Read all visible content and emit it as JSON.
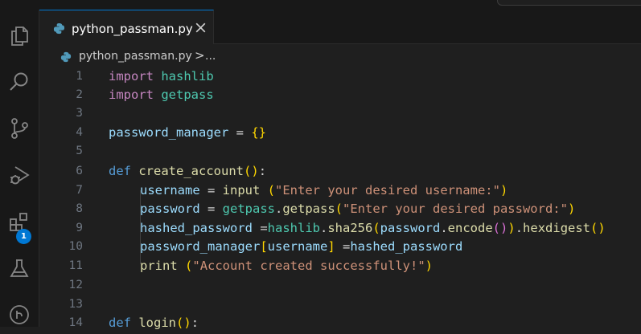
{
  "tab": {
    "filename": "python_passman.py"
  },
  "breadcrumb": {
    "file": "python_passman.py",
    "separator": ">",
    "more": "..."
  },
  "activity_bar": {
    "items": [
      "files-icon",
      "search-icon",
      "source-control-icon",
      "run-debug-icon",
      "extensions-icon",
      "testing-icon",
      "git-graph-icon"
    ],
    "extensions_badge": "1"
  },
  "colors": {
    "accent": "#0078d4",
    "keyword": "#c586c0",
    "def_keyword": "#569cd6",
    "function": "#dcdcaa",
    "module": "#4ec9b0",
    "variable": "#9cdcfe",
    "string": "#ce9178"
  },
  "code": {
    "line_numbers": [
      "1",
      "2",
      "3",
      "4",
      "5",
      "6",
      "7",
      "8",
      "9",
      "10",
      "11",
      "12",
      "13",
      "14"
    ],
    "l1": {
      "kw": "import",
      "sp": " ",
      "mod": "hashlib"
    },
    "l2": {
      "kw": "import",
      "sp": " ",
      "mod": "getpass"
    },
    "l4": {
      "var": "password_manager",
      "op": " = ",
      "br": "{}"
    },
    "l6": {
      "kw": "def",
      "sp": " ",
      "fn": "create_account",
      "o": "(",
      "c": ")",
      "colon": ":"
    },
    "l7": {
      "var": "username",
      "op": " = ",
      "fn": "input",
      "sp": " ",
      "o": "(",
      "str": "\"Enter your desired username:\"",
      "c": ")"
    },
    "l8": {
      "var": "password",
      "op": " = ",
      "mod": "getpass",
      "dot": ".",
      "fn": "getpass",
      "o": "(",
      "str": "\"Enter your desired password:\"",
      "c": ")"
    },
    "l9": {
      "var1": "hashed_password",
      "op": " =",
      "mod": "hashlib",
      "dot1": ".",
      "fn1": "sha256",
      "o1": "(",
      "var2": "password",
      "dot2": ".",
      "fn2": "encode",
      "o2": "()",
      "c1": ")",
      "dot3": ".",
      "fn3": "hexdigest",
      "o3": "()"
    },
    "l10": {
      "var1": "password_manager",
      "o": "[",
      "var2": "username",
      "c": "]",
      "op": " =",
      "var3": "hashed_password"
    },
    "l11": {
      "fn": "print",
      "sp": " ",
      "o": "(",
      "str": "\"Account created successfully!\"",
      "c": ")"
    },
    "l14": {
      "kw": "def",
      "sp": " ",
      "fn": "login",
      "o": "(",
      "c": ")",
      "colon": ":"
    }
  }
}
